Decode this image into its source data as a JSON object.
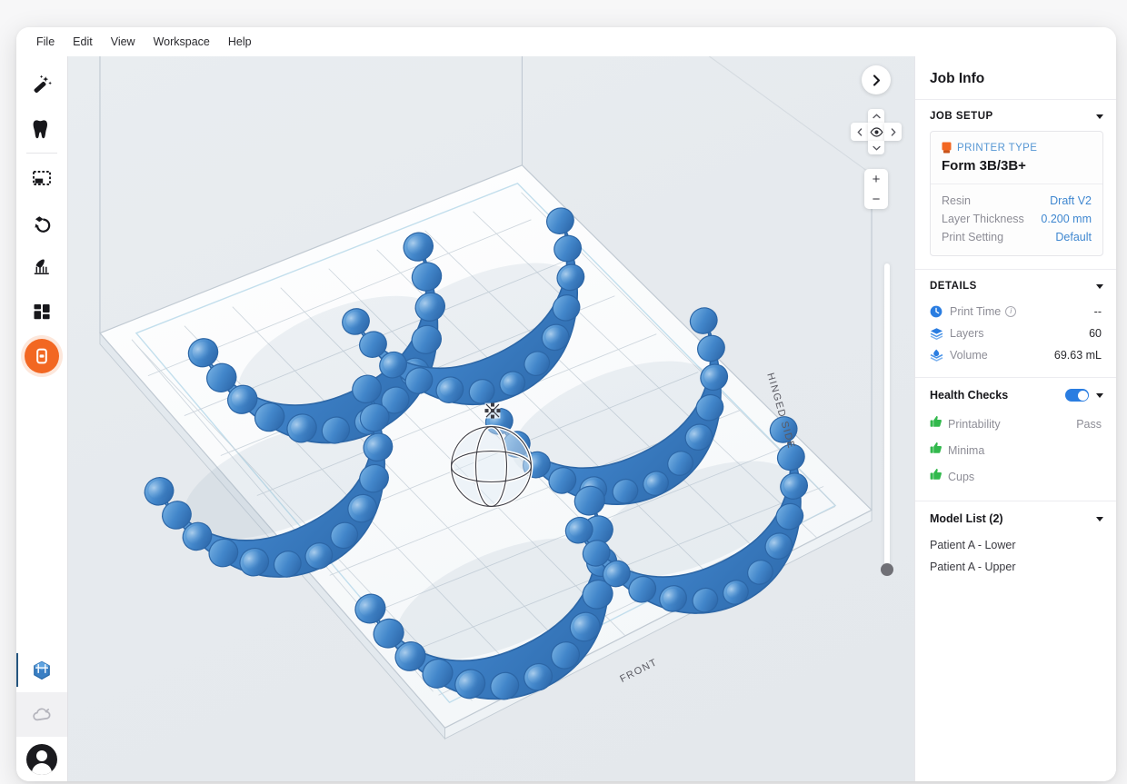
{
  "menubar": {
    "items": [
      {
        "label": "File"
      },
      {
        "label": "Edit"
      },
      {
        "label": "View"
      },
      {
        "label": "Workspace"
      },
      {
        "label": "Help"
      }
    ]
  },
  "toolbar": {
    "top_items": [
      {
        "name": "magic-wand-icon",
        "tooltip": "One-Click Print"
      },
      {
        "name": "tooth-icon",
        "tooltip": "Dental Tools"
      },
      {
        "name": "selection-box-icon",
        "tooltip": "Select"
      },
      {
        "name": "orientation-icon",
        "tooltip": "Orient"
      },
      {
        "name": "supports-icon",
        "tooltip": "Supports"
      },
      {
        "name": "layout-grid-icon",
        "tooltip": "Layout"
      },
      {
        "name": "printer-icon",
        "tooltip": "Print"
      }
    ],
    "bottom_items": [
      {
        "name": "cube-3d-icon",
        "tooltip": "Scene"
      },
      {
        "name": "cloud-icon",
        "tooltip": "Dashboard"
      },
      {
        "name": "avatar-icon",
        "tooltip": "Account"
      }
    ]
  },
  "viewport": {
    "labels": {
      "front": "FRONT",
      "hinged_side": "HINGED SIDE"
    },
    "nav": {
      "collapse_icon": "chevron-right-icon",
      "pan_up": "chevron-up-icon",
      "pan_down": "chevron-down-icon",
      "pan_left": "chevron-left-icon",
      "pan_right": "chevron-right-icon",
      "center_icon": "eye-icon",
      "zoom_in": "+",
      "zoom_out": "−"
    },
    "model_color": "#3a7fc4",
    "gizmo": {
      "name": "rotation-gizmo",
      "handle": "move-handle-icon"
    }
  },
  "panel": {
    "title": "Job Info",
    "job_setup": {
      "heading": "JOB SETUP",
      "printer_type_label": "PRINTER TYPE",
      "printer_name": "Form 3B/3B+",
      "printer_icon_color": "#f26722",
      "rows": [
        {
          "key": "Resin",
          "value": "Draft V2"
        },
        {
          "key": "Layer Thickness",
          "value": "0.200 mm"
        },
        {
          "key": "Print Setting",
          "value": "Default"
        }
      ]
    },
    "details": {
      "heading": "DETAILS",
      "rows": [
        {
          "icon": "clock-icon",
          "label": "Print Time",
          "value": "--",
          "has_info": true
        },
        {
          "icon": "layers-icon",
          "label": "Layers",
          "value": "60",
          "has_info": false
        },
        {
          "icon": "volume-droplet-icon",
          "label": "Volume",
          "value": "69.63 mL",
          "has_info": false
        }
      ]
    },
    "health_checks": {
      "heading": "Health Checks",
      "master_toggle_on": true,
      "rows": [
        {
          "icon": "thumbs-up-icon",
          "label": "Printability",
          "value": "Pass",
          "type": "text"
        },
        {
          "icon": "thumbs-up-icon",
          "label": "Minima",
          "value": "",
          "type": "toggle"
        },
        {
          "icon": "thumbs-up-icon",
          "label": "Cups",
          "value": "",
          "type": "toggle"
        }
      ]
    },
    "model_list": {
      "heading": "Model List (2)",
      "items": [
        {
          "label": "Patient A - Lower"
        },
        {
          "label": "Patient A - Upper"
        }
      ]
    }
  }
}
